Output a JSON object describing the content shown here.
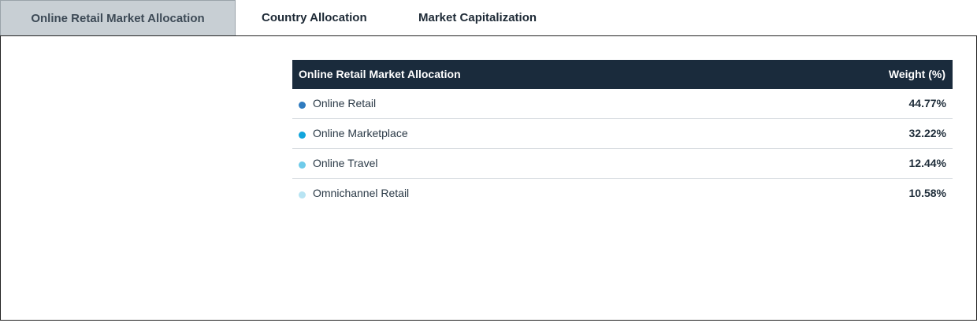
{
  "tabs": [
    {
      "label": "Online Retail Market Allocation",
      "active": true
    },
    {
      "label": "Country Allocation",
      "active": false
    },
    {
      "label": "Market Capitalization",
      "active": false
    }
  ],
  "table": {
    "header_label": "Online Retail Market Allocation",
    "header_weight": "Weight (%)",
    "rows": [
      {
        "label": "Online Retail",
        "value": "44.77%",
        "color": "#2f7bbf"
      },
      {
        "label": "Online Marketplace",
        "value": "32.22%",
        "color": "#12a5dc"
      },
      {
        "label": "Online Travel",
        "value": "12.44%",
        "color": "#6fcbea"
      },
      {
        "label": "Omnichannel Retail",
        "value": "10.58%",
        "color": "#b8e4f3"
      }
    ]
  }
}
